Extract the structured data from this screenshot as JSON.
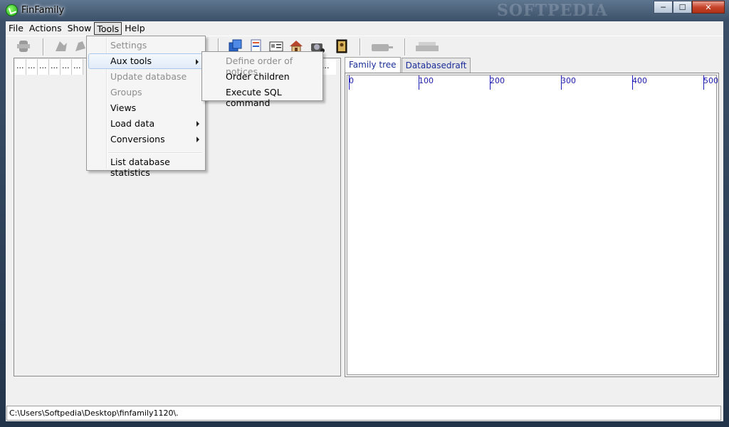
{
  "window": {
    "title": "FinFamily",
    "watermark": "SOFTPEDIA",
    "controls": {
      "minimize": "─",
      "maximize": "☐",
      "close": "✕"
    }
  },
  "menubar": {
    "items": [
      {
        "label": "File",
        "name": "menu-file"
      },
      {
        "label": "Actions",
        "name": "menu-actions"
      },
      {
        "label": "Show",
        "name": "menu-show"
      },
      {
        "label": "Tools",
        "name": "menu-tools",
        "active": true
      },
      {
        "label": "Help",
        "name": "menu-help"
      }
    ]
  },
  "tools_menu": {
    "items": [
      {
        "label": "Settings",
        "enabled": false
      },
      {
        "label": "Aux tools",
        "enabled": true,
        "submenu": true,
        "highlighted": true
      },
      {
        "label": "Update database",
        "enabled": false
      },
      {
        "label": "Groups",
        "enabled": false
      },
      {
        "label": "Views",
        "enabled": true
      },
      {
        "label": "Load data",
        "enabled": true,
        "submenu": true
      },
      {
        "label": "Conversions",
        "enabled": true,
        "submenu": true
      },
      {
        "label": "List database statistics",
        "enabled": true
      }
    ]
  },
  "aux_submenu": {
    "items": [
      {
        "label": "Define order of notices",
        "enabled": false
      },
      {
        "label": "Order children",
        "enabled": true
      },
      {
        "label": "Execute SQL command",
        "enabled": true
      }
    ]
  },
  "left_list": {
    "column_headers": [
      "...",
      "...",
      "...",
      "...",
      "...",
      "..."
    ],
    "right_header": "..."
  },
  "tabs": [
    {
      "label": "Family tree",
      "selected": true
    },
    {
      "label": "Databasedraft",
      "selected": false
    }
  ],
  "ruler": {
    "labels": [
      "0",
      "100",
      "200",
      "300",
      "400",
      "500"
    ]
  },
  "status": {
    "path": "C:\\Users\\Softpedia\\Desktop\\finfamily1120\\."
  }
}
